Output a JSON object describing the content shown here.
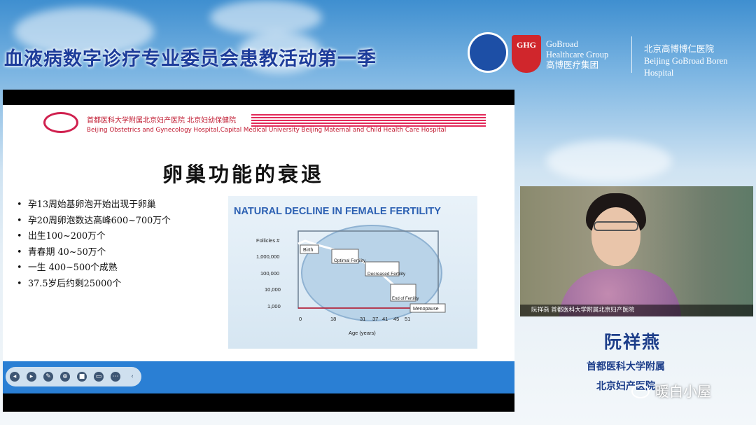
{
  "banner": {
    "title": "血液病数字诊疗专业委员会患教活动第一季",
    "ghg": {
      "abbr": "GHG",
      "line1": "GoBroad",
      "line2": "Healthcare Group",
      "line3": "高博医疗集团"
    },
    "hospital": {
      "cn": "北京高博博仁医院",
      "en": "Beijing GoBroad Boren Hospital"
    }
  },
  "slide": {
    "hospital_cn": "首都医科大学附属北京妇产医院 北京妇幼保健院",
    "hospital_en": "Beijing Obstetrics and Gynecology Hospital,Capital Medical University Beijing Maternal and Child Health Care Hospital",
    "title": "卵巢功能的衰退",
    "bullets": [
      "孕13周始基卵泡开始出现于卵巢",
      "孕20周卵泡数达高峰600~700万个",
      "出生100~200万个",
      "青春期 40~50万个",
      "一生 400~500个成熟",
      "37.5岁后约剩25000个"
    ],
    "figure": {
      "title": "NATURAL DECLINE IN FEMALE FERTILITY",
      "ylabel": "Follicles #",
      "xlabel": "Age (years)",
      "yticks": [
        "1,000,000",
        "100,000",
        "10,000",
        "1,000"
      ],
      "xticks": [
        "0",
        "18",
        "31",
        "37",
        "41",
        "45",
        "51"
      ],
      "annotations": [
        "Birth",
        "Optimal Fertility",
        "Decreased Fertility",
        "End of Fertility",
        "Menopause"
      ]
    }
  },
  "video": {
    "name_bar": "阮祥燕 首都医科大学附属北京妇产医院"
  },
  "speaker": {
    "name": "阮祥燕",
    "aff1": "首都医科大学附属",
    "aff2": "北京妇产医院"
  },
  "watermark": "暖白小屋",
  "colors": {
    "accent": "#1d3e8a",
    "control_bar": "#2a7fd4",
    "hospital_red": "#c0182f"
  }
}
